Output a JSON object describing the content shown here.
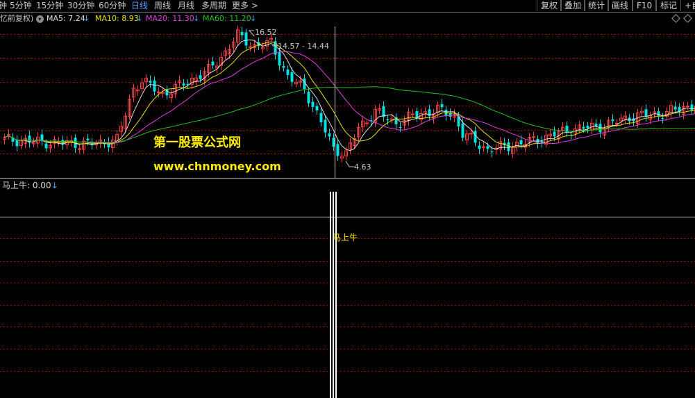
{
  "toolbar": {
    "periods": [
      {
        "label": "钟"
      },
      {
        "label": "5分钟"
      },
      {
        "label": "15分钟"
      },
      {
        "label": "30分钟"
      },
      {
        "label": "60分钟"
      },
      {
        "label": "日线"
      },
      {
        "label": "周线"
      },
      {
        "label": "月线"
      },
      {
        "label": "多周期"
      },
      {
        "label": "更多 >"
      }
    ],
    "active_period": "日线",
    "right_buttons": [
      {
        "label": "复权"
      },
      {
        "label": "叠加"
      },
      {
        "label": "统计"
      },
      {
        "label": "画线"
      },
      {
        "label": "F10"
      },
      {
        "label": "标记"
      },
      {
        "label": "+自"
      }
    ]
  },
  "legend": {
    "adjust": "忆前复权)",
    "ma5": {
      "text": "MA5: 7.24",
      "color": "#e0e0e0"
    },
    "ma10": {
      "text": "MA10: 8.93",
      "color": "#e8e000"
    },
    "ma20": {
      "text": "MA20: 11.30",
      "color": "#e040e0"
    },
    "ma60": {
      "text": "MA60: 11.20",
      "color": "#20c020"
    },
    "arrow": "↓"
  },
  "annotations": {
    "high": "16.52",
    "crosshair_range": "14.57 - 14.44",
    "low": "4.63"
  },
  "watermark": {
    "line1": "第一股票公式网",
    "line2": "www.chnmoney.com"
  },
  "indicator": {
    "name": "马上牛",
    "label": "马上牛: 0.00",
    "arrow": "↓",
    "signal_label": "马上牛"
  },
  "colors": {
    "up": "#ff3c3c",
    "down": "#00e0e0",
    "grid": "#a00000",
    "ma5": "#e0e0e0",
    "ma10": "#e8e000",
    "ma20": "#e040e0",
    "ma60": "#20c020",
    "watermark": "#ffee00",
    "signal": "#ffffff"
  },
  "chart_data": {
    "type": "candlestick",
    "series": [
      {
        "name": "MA5",
        "latest": 7.24
      },
      {
        "name": "MA10",
        "latest": 8.93
      },
      {
        "name": "MA20",
        "latest": 11.3
      },
      {
        "name": "MA60",
        "latest": 11.2
      }
    ],
    "high": 16.52,
    "low": 4.63,
    "indicator": {
      "name": "马上牛",
      "value": 0.0
    }
  }
}
